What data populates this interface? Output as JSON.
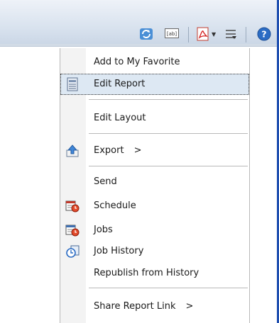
{
  "toolbar": {
    "refresh_icon": "refresh-icon",
    "ab_icon": "text-field-icon",
    "pdf_icon": "pdf-icon",
    "actions_icon": "actions-menu-icon",
    "help_icon": "help-icon",
    "accent_color": "#1f4fb0"
  },
  "menu": {
    "items": [
      {
        "label": "Add to My Favorite"
      },
      {
        "label": "Edit Report",
        "icon": "edit-report-icon"
      },
      {
        "label": "Edit Layout"
      },
      {
        "label": "Export",
        "icon": "export-icon",
        "arrow": ">"
      },
      {
        "label": "Send"
      },
      {
        "label": "Schedule",
        "icon": "schedule-icon"
      },
      {
        "label": "Jobs",
        "icon": "jobs-icon"
      },
      {
        "label": "Job History",
        "icon": "job-history-icon"
      },
      {
        "label": "Republish from History"
      },
      {
        "label": "Share Report Link",
        "arrow": ">"
      }
    ],
    "highlighted_item": "Edit Report"
  }
}
